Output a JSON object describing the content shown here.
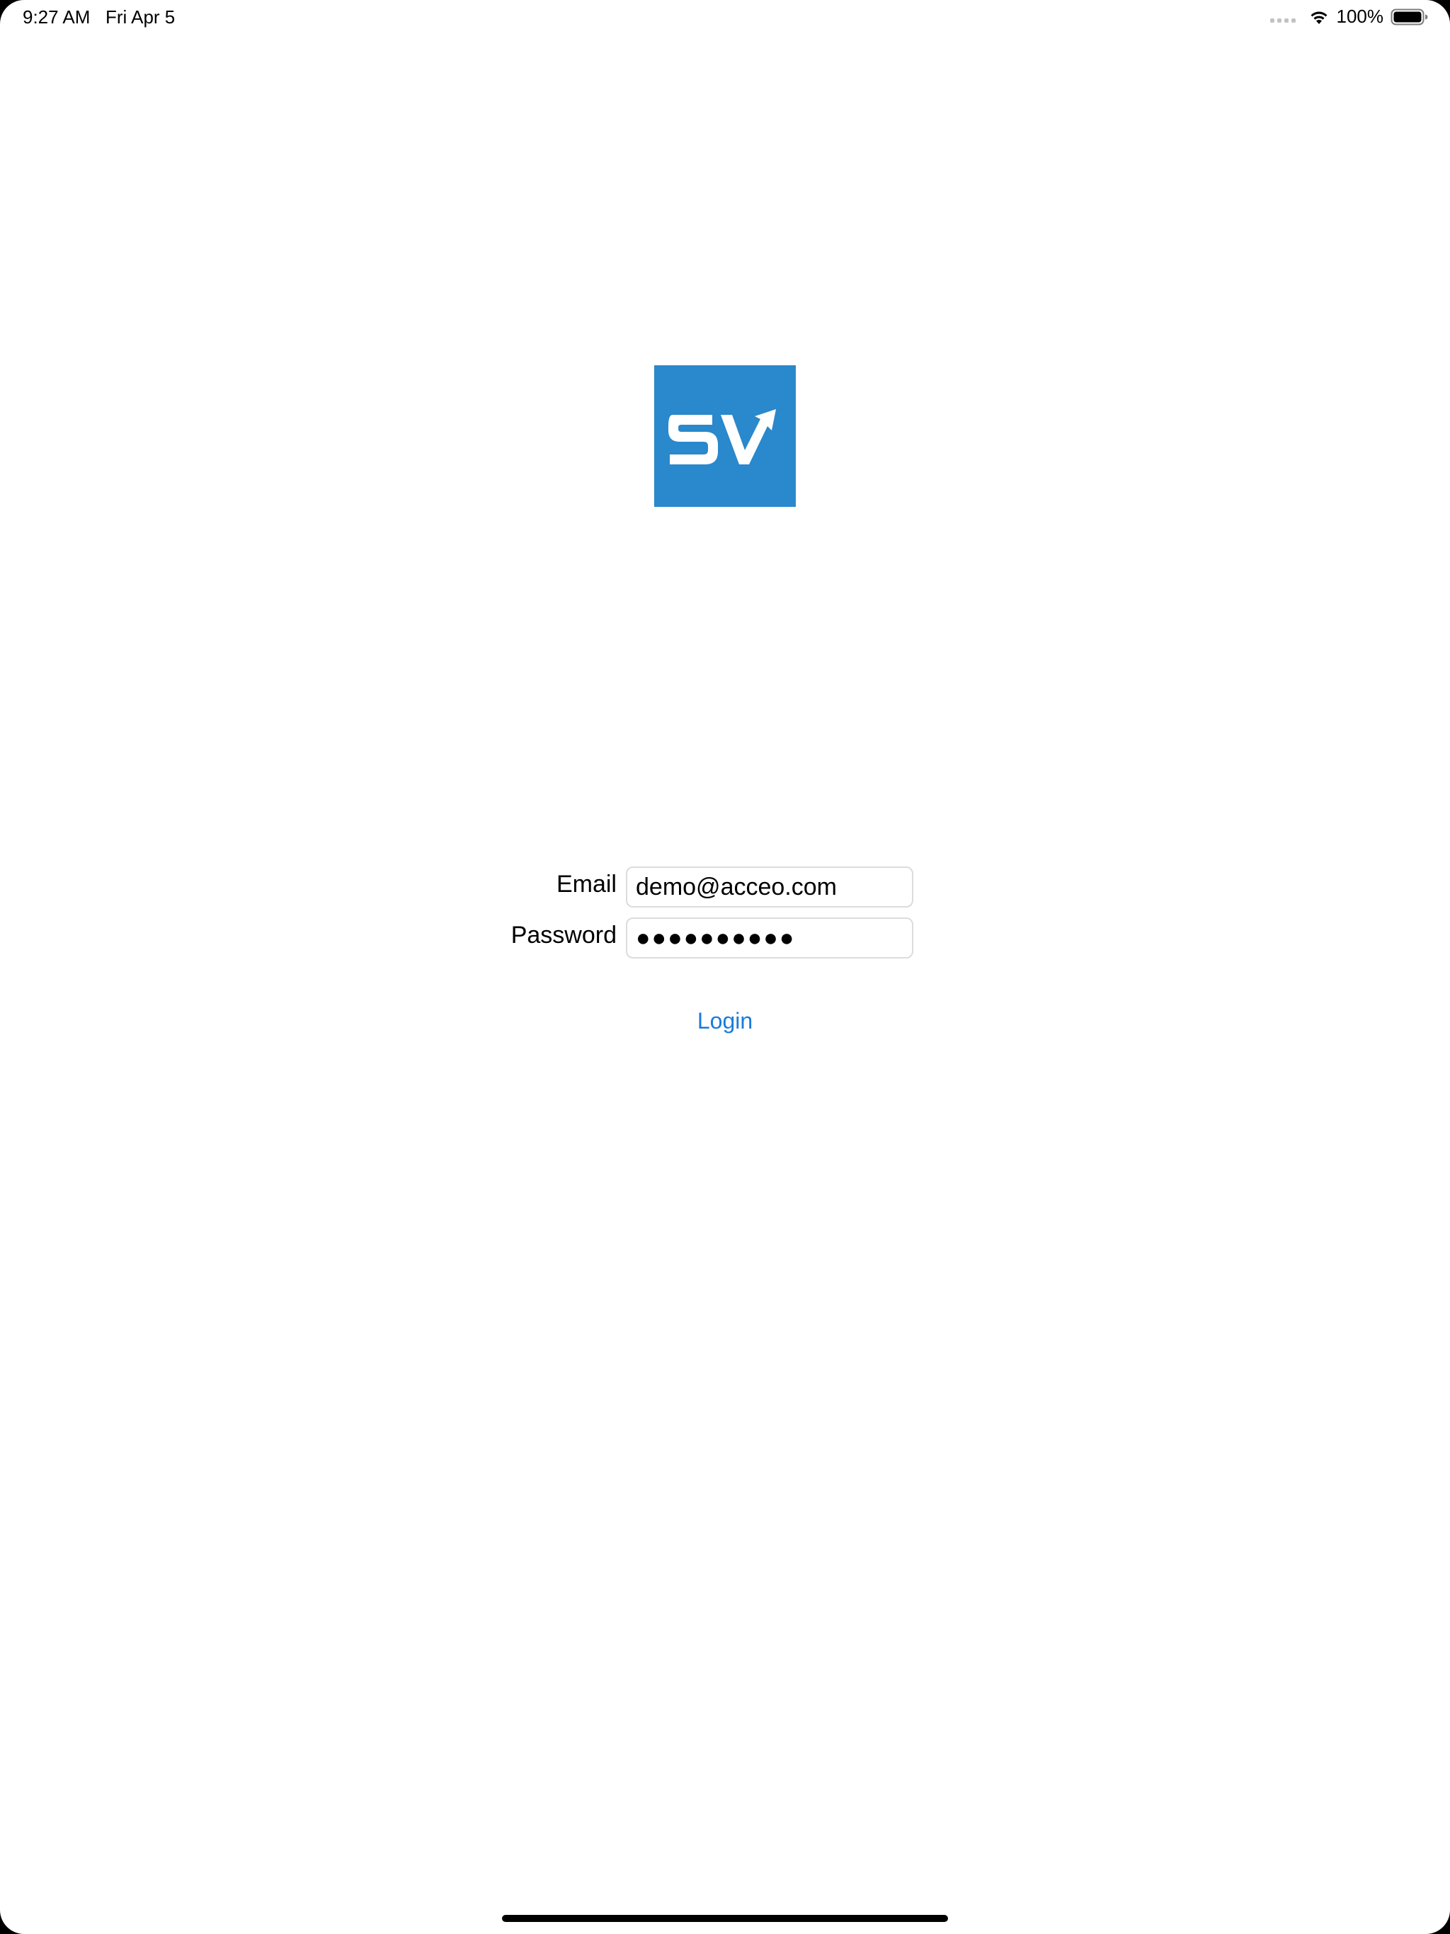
{
  "status_bar": {
    "time": "9:27 AM",
    "date": "Fri Apr 5",
    "battery_percent": "100%",
    "wifi_icon": "wifi-icon",
    "battery_icon": "battery-full-icon"
  },
  "logo": {
    "text": "SV",
    "background_color": "#2a88cc",
    "foreground_color": "#ffffff"
  },
  "form": {
    "email_label": "Email",
    "email_value": "demo@acceo.com",
    "password_label": "Password",
    "password_value": "●●●●●●●●●●",
    "login_label": "Login"
  },
  "colors": {
    "accent": "#1a7bd9"
  }
}
